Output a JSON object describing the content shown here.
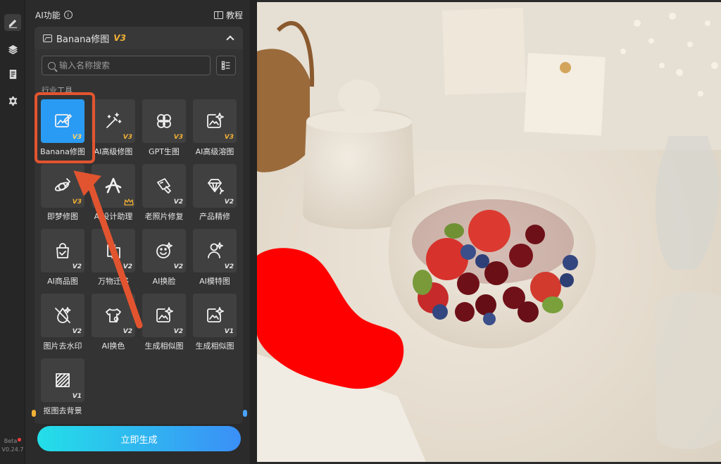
{
  "rail": {
    "items": [
      {
        "name": "edit",
        "active": true
      },
      {
        "name": "layers",
        "active": false
      },
      {
        "name": "document",
        "active": false
      },
      {
        "name": "settings",
        "active": false
      }
    ],
    "beta": "Beta",
    "version": "V0.24.7"
  },
  "panel": {
    "title": "AI功能",
    "info_icon_text": "i",
    "tutorial": "教程",
    "section": {
      "name": "Banana修图",
      "version": "V3"
    },
    "search": {
      "placeholder": "输入名称搜索",
      "value": ""
    },
    "category": "行业工具",
    "tools": [
      {
        "label": "Banana修图",
        "badge": "V3",
        "icon": "image-edit-icon",
        "selected": true
      },
      {
        "label": "AI高级修图",
        "badge": "V3",
        "icon": "magic-wand-icon"
      },
      {
        "label": "GPT生图",
        "badge": "V3",
        "icon": "gpt-knot-icon"
      },
      {
        "label": "AI高级溶图",
        "badge": "V3",
        "icon": "image-sparkle-icon"
      },
      {
        "label": "即梦修图",
        "badge": "V3",
        "icon": "planet-brush-icon"
      },
      {
        "label": "AI设计助理",
        "badge": "",
        "icon": "design-a-icon",
        "crown": true
      },
      {
        "label": "老照片修复",
        "badge": "V2",
        "icon": "photo-repair-icon"
      },
      {
        "label": "产品精修",
        "badge": "V2",
        "icon": "diamond-icon"
      },
      {
        "label": "AI商品图",
        "badge": "V2",
        "icon": "product-bag-icon"
      },
      {
        "label": "万物迁移",
        "badge": "V2",
        "icon": "transfer-icon"
      },
      {
        "label": "AI换脸",
        "badge": "V2",
        "icon": "face-swap-icon"
      },
      {
        "label": "AI模特图",
        "badge": "V2",
        "icon": "model-person-icon"
      },
      {
        "label": "图片去水印",
        "badge": "V2",
        "icon": "watermark-remove-icon"
      },
      {
        "label": "AI换色",
        "badge": "V2",
        "icon": "shirt-color-icon"
      },
      {
        "label": "生成相似图",
        "badge": "V2",
        "icon": "similar-image-icon"
      },
      {
        "label": "生成相似图",
        "badge": "V1",
        "icon": "similar-image-icon"
      },
      {
        "label": "抠图去背景",
        "badge": "V1",
        "icon": "cutout-hatch-icon"
      }
    ],
    "generate_label": "立即生成"
  },
  "colors": {
    "accent": "#2a9bf4",
    "highlight": "#e2542f",
    "version_gold": "#f2b134",
    "annotation_red": "#ff0000"
  }
}
